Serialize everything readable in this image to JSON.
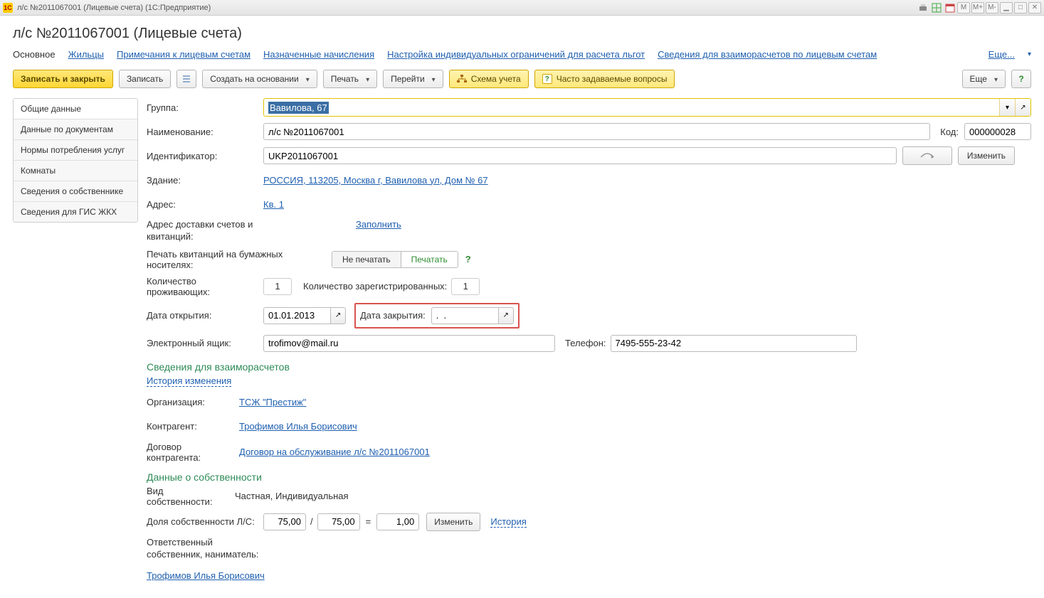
{
  "window": {
    "title": "л/с №2011067001 (Лицевые счета)   (1С:Предприятие)"
  },
  "titlebar_icons": [
    "M",
    "M+",
    "M-"
  ],
  "page": {
    "title": "л/с №2011067001 (Лицевые счета)"
  },
  "nav": {
    "main": "Основное",
    "tenants": "Жильцы",
    "notes": "Примечания к лицевым счетам",
    "accruals": "Назначенные начисления",
    "limits": "Настройка индивидуальных ограничений для расчета льгот",
    "settlements": "Сведения для взаиморасчетов по лицевым счетам",
    "more": "Еще..."
  },
  "toolbar": {
    "save_close": "Записать и закрыть",
    "save": "Записать",
    "create_based": "Создать на основании",
    "print": "Печать",
    "goto": "Перейти",
    "scheme": "Схема учета",
    "faq": "Часто задаваемые вопросы",
    "more": "Еще",
    "help": "?"
  },
  "side_tabs": [
    "Общие данные",
    "Данные по документам",
    "Нормы потребления услуг",
    "Комнаты",
    "Сведения о собственнике",
    "Сведения для ГИС ЖКХ"
  ],
  "labels": {
    "group": "Группа:",
    "name": "Наименование:",
    "code": "Код:",
    "id": "Идентификатор:",
    "building": "Здание:",
    "address": "Адрес:",
    "delivery_addr": "Адрес доставки счетов и квитанций:",
    "fill": "Заполнить",
    "print_paper": "Печать квитанций на бумажных носителях:",
    "no_print": "Не печатать",
    "do_print": "Печатать",
    "residents": "Количество проживающих:",
    "registered": "Количество зарегистрированных:",
    "open_date": "Дата открытия:",
    "close_date": "Дата закрытия:",
    "email": "Электронный ящик:",
    "phone": "Телефон:",
    "sect_settlement": "Сведения для взаиморасчетов",
    "history": "История изменения",
    "org": "Организация:",
    "counterparty": "Контрагент:",
    "contract": "Договор контрагента:",
    "sect_ownership": "Данные о собственности",
    "ownership_type": "Вид собственности:",
    "share": "Доля собственности Л/С:",
    "slash": "/",
    "eq": "=",
    "change": "Изменить",
    "history2": "История",
    "resp_owner": "Ответственный собственник, наниматель:",
    "edit_btn": "Изменить"
  },
  "values": {
    "group": "Вавилова, 67",
    "name": "л/с №2011067001",
    "code": "000000028",
    "id": "UKP2011067001",
    "building": "РОССИЯ, 113205, Москва г, Вавилова ул, Дом № 67",
    "address": "Кв. 1",
    "residents": "1",
    "registered": "1",
    "open_date": "01.01.2013",
    "close_date": ".  .",
    "email": "trofimov@mail.ru",
    "phone": "7495-555-23-42",
    "org": "ТСЖ \"Престиж\"",
    "counterparty": "Трофимов Илья Борисович",
    "contract": "Договор на обслуживание л/с №2011067001",
    "ownership_type": "Частная, Индивидуальная",
    "share_a": "75,00",
    "share_b": "75,00",
    "share_res": "1,00",
    "resp_owner": "Трофимов Илья Борисович"
  }
}
